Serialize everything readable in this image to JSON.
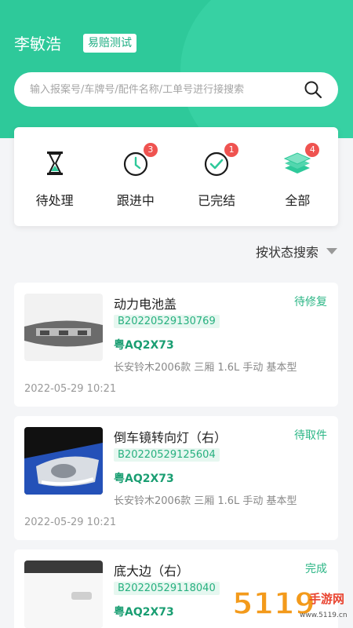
{
  "user": {
    "name": "李敏浩",
    "tag": "易赔测试"
  },
  "search": {
    "placeholder": "输入报案号/车牌号/配件名称/工单号进行接搜索"
  },
  "statuses": [
    {
      "label": "待处理",
      "icon": "hourglass-icon",
      "badge": ""
    },
    {
      "label": "跟进中",
      "icon": "clock-icon",
      "badge": "3"
    },
    {
      "label": "已完结",
      "icon": "check-circle-icon",
      "badge": "1"
    },
    {
      "label": "全部",
      "icon": "layers-icon",
      "badge": "4"
    }
  ],
  "filter": {
    "label": "按状态搜索"
  },
  "orders": [
    {
      "part": "动力电池盖",
      "status": "待修复",
      "order_no": "B20220529130769",
      "plate": "粤AQ2X73",
      "model": "长安铃木2006款 三厢 1.6L 手动 基本型",
      "date": "2022-05-29 10:21"
    },
    {
      "part": "倒车镜转向灯（右）",
      "status": "待取件",
      "order_no": "B20220529125604",
      "plate": "粤AQ2X73",
      "model": "长安铃木2006款 三厢 1.6L 手动 基本型",
      "date": "2022-05-29 10:21"
    },
    {
      "part": "底大边（右）",
      "status": "完成",
      "order_no": "B20220529118040",
      "plate": "粤AQ2X73",
      "model": "",
      "date": ""
    }
  ],
  "watermark": {
    "text": "手游网",
    "domain": "www.5119.cn",
    "num": "5119"
  },
  "colors": {
    "brand": "#2ec99a",
    "badge": "#ef5350",
    "status": "#2cb686"
  }
}
